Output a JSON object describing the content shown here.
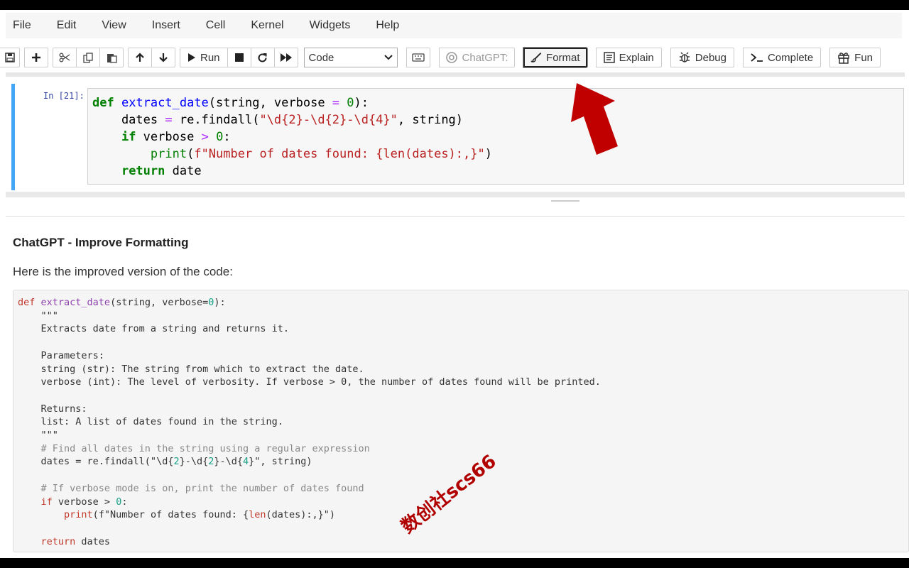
{
  "menu": [
    "File",
    "Edit",
    "View",
    "Insert",
    "Cell",
    "Kernel",
    "Widgets",
    "Help"
  ],
  "toolbar": {
    "run_label": "Run",
    "cell_type": "Code",
    "chatgpt_label": "ChatGPT:",
    "format_label": "Format",
    "explain_label": "Explain",
    "debug_label": "Debug",
    "complete_label": "Complete",
    "fun_label": "Fun"
  },
  "cell": {
    "prompt": "In [21]:",
    "code_lines": [
      "def extract_date(string, verbose = 0):",
      "    dates = re.findall(\"\\d{2}-\\d{2}-\\d{4}\", string)",
      "    if verbose > 0:",
      "        print(f\"Number of dates found: {len(dates):,}\")",
      "    return date"
    ]
  },
  "response": {
    "title": "ChatGPT - Improve Formatting",
    "intro": "Here is the improved version of the code:",
    "code_lines": [
      "def extract_date(string, verbose=0):",
      "    \"\"\"",
      "    Extracts date from a string and returns it.",
      "",
      "    Parameters:",
      "    string (str): The string from which to extract the date.",
      "    verbose (int): The level of verbosity. If verbose > 0, the number of dates found will be printed.",
      "",
      "    Returns:",
      "    list: A list of dates found in the string.",
      "    \"\"\"",
      "    # Find all dates in the string using a regular expression",
      "    dates = re.findall(\"\\d{2}-\\d{2}-\\d{4}\", string)",
      "",
      "    # If verbose mode is on, print the number of dates found",
      "    if verbose > 0:",
      "        print(f\"Number of dates found: {len(dates):,}\")",
      "",
      "    return dates"
    ]
  },
  "watermark": "数创社scs66",
  "colors": {
    "arrow": "#c00000",
    "cell_border": "#42a5f5"
  }
}
